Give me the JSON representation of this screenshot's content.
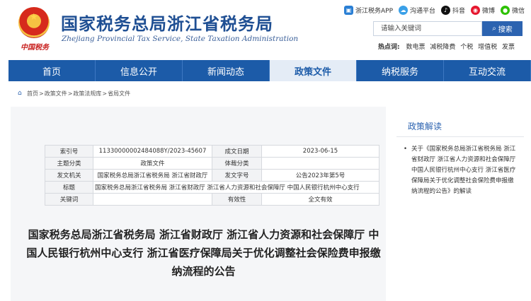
{
  "header": {
    "title": "国家税务总局浙江省税务局",
    "subtitle": "Zhejiang Provincial Tax Service, State Taxation Administration",
    "emblem_caption": "中国税务",
    "quick_links": [
      {
        "label": "浙江税务APP",
        "icon": "app-icon"
      },
      {
        "label": "沟通平台",
        "icon": "cloud-icon"
      },
      {
        "label": "抖音",
        "icon": "tiktok-icon"
      },
      {
        "label": "微博",
        "icon": "weibo-icon"
      },
      {
        "label": "微信",
        "icon": "wechat-icon"
      }
    ],
    "search": {
      "placeholder": "请输入关键词",
      "button": "搜索"
    },
    "hot": {
      "label": "热点词:",
      "items": [
        "数电票",
        "减税降费",
        "个税",
        "增值税",
        "发票"
      ]
    }
  },
  "nav": {
    "items": [
      "首页",
      "信息公开",
      "新闻动态",
      "政策文件",
      "纳税服务",
      "互动交流"
    ],
    "active_index": 3
  },
  "breadcrumb": [
    "首页",
    "政策文件",
    "政策法规库",
    "省局文件"
  ],
  "meta": {
    "rows": [
      {
        "k1": "索引号",
        "v1": "11330000002484088Y/2023-45607",
        "k2": "成文日期",
        "v2": "2023-06-15"
      },
      {
        "k1": "主题分类",
        "v1": "政策文件",
        "k2": "体裁分类",
        "v2": ""
      },
      {
        "k1": "发文机关",
        "v1": "国家税务总局浙江省税务局 浙江省财政厅",
        "k2": "发文字号",
        "v2": "公告2023年第5号"
      }
    ],
    "title_label": "标题",
    "title_value": "国家税务总局浙江省税务局 浙江省财政厅 浙江省人力资源和社会保障厅 中国人民银行杭州中心支行",
    "keyword_label": "关键词",
    "keyword_value": "",
    "validity_label": "有效性",
    "validity_value": "全文有效"
  },
  "document": {
    "title": "国家税务总局浙江省税务局 浙江省财政厅 浙江省人力资源和社会保障厅 中国人民银行杭州中心支行 浙江省医疗保障局关于优化调整社会保险费申报缴纳流程的公告"
  },
  "sidebar": {
    "title": "政策解读",
    "items": [
      "关于《国家税务总局浙江省税务局 浙江省财政厅 浙江省人力资源和社会保障厅 中国人民银行杭州中心支行 浙江省医疗保障局关于优化调整社会保险费申报缴纳流程的公告》的解读"
    ]
  }
}
